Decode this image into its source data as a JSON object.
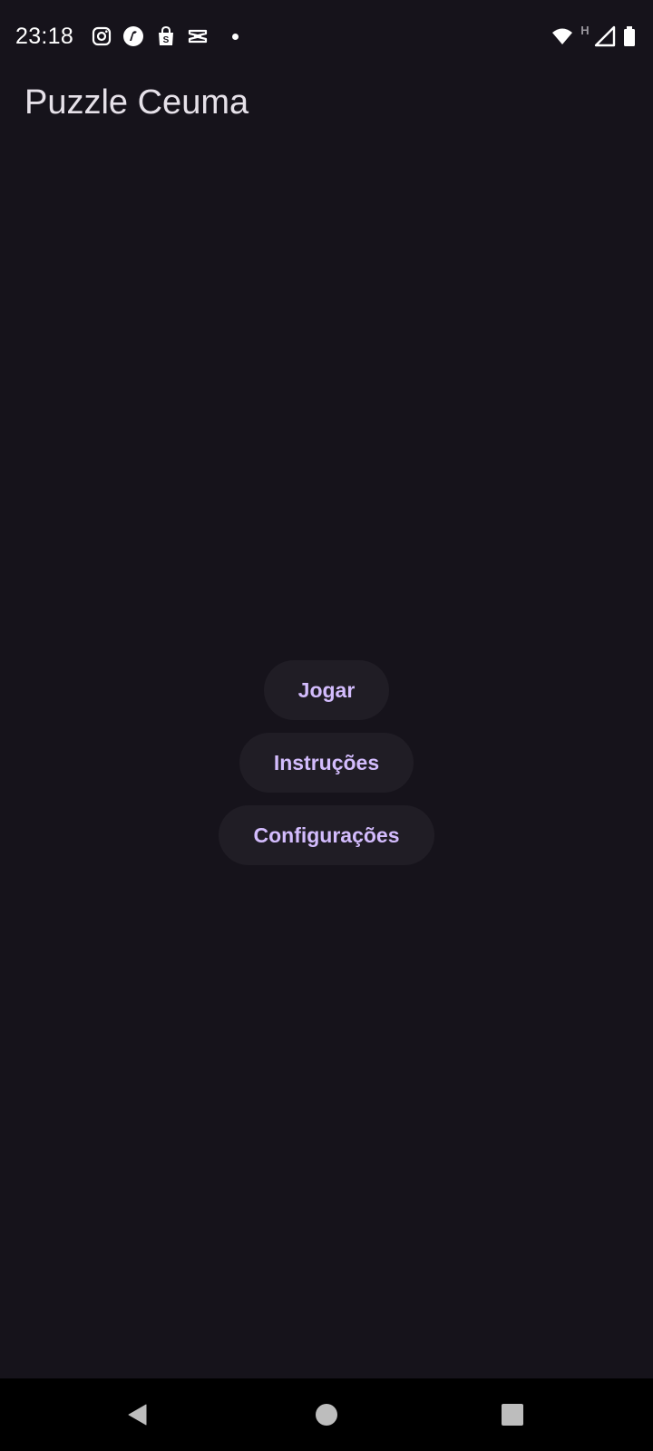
{
  "status_bar": {
    "time": "23:18",
    "notification_icons": [
      "instagram-icon",
      "reddit-like-app-icon",
      "shopping-bag-icon",
      "capcut-icon",
      "more-notifications-dot"
    ],
    "system_icons": [
      "wifi-icon",
      "network-type-h-icon",
      "cellular-signal-icon",
      "battery-icon"
    ],
    "network_type": "H"
  },
  "app_bar": {
    "title": "Puzzle Ceuma"
  },
  "menu": {
    "play_label": "Jogar",
    "instructions_label": "Instruções",
    "settings_label": "Configurações"
  },
  "navigation": {
    "items": [
      "back-icon",
      "home-icon",
      "recents-icon"
    ]
  },
  "colors": {
    "background": "#16131b",
    "button_background": "#201d25",
    "button_text": "#d3bcfd",
    "title_text": "#e6e1e9"
  }
}
